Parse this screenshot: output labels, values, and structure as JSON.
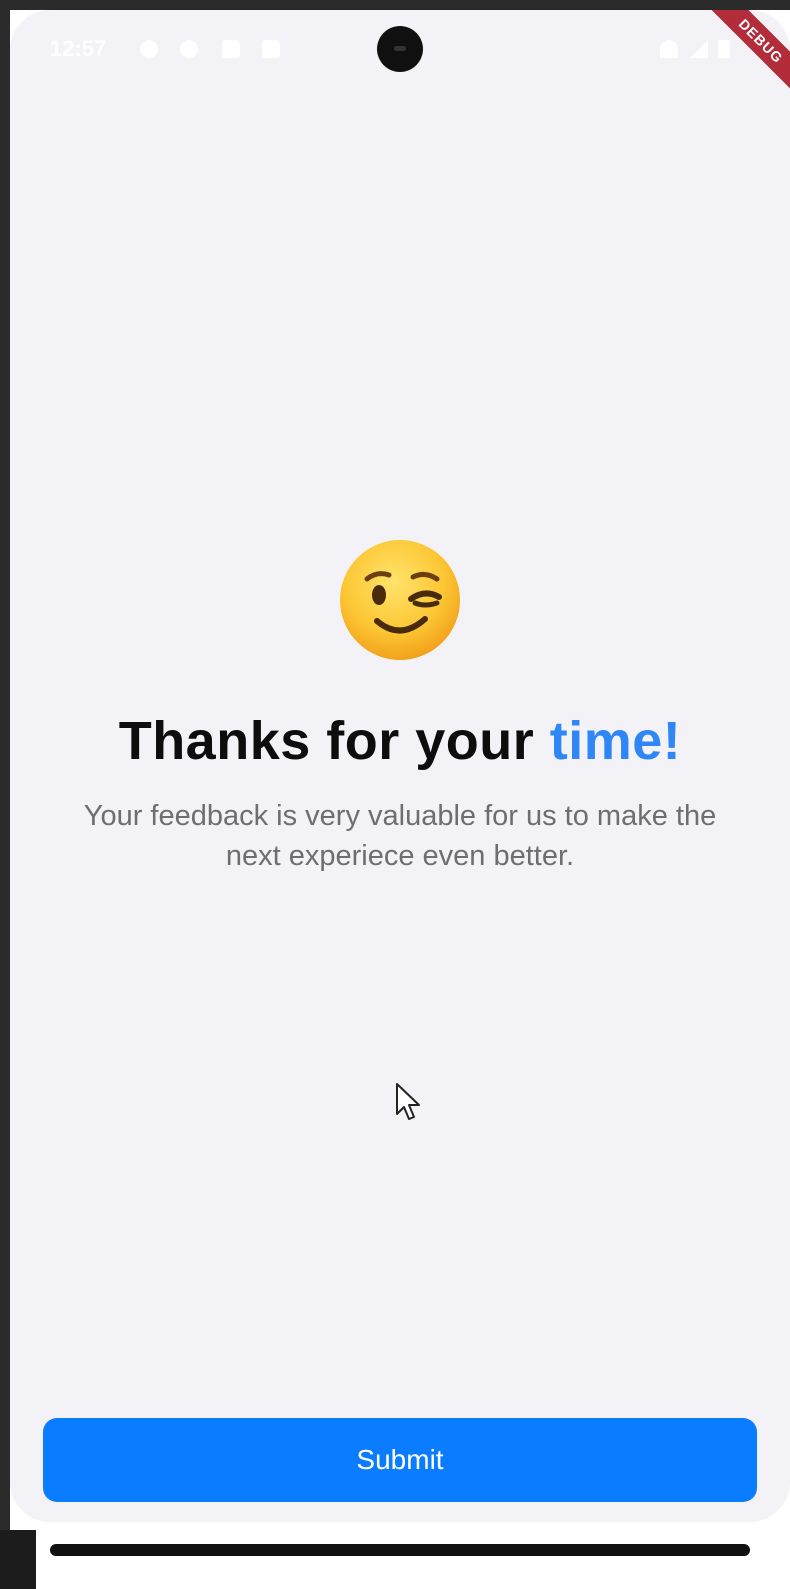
{
  "status_bar": {
    "time": "12:57"
  },
  "debug_banner": {
    "label": "DEBUG"
  },
  "feedback": {
    "emoji_icon": "winking-face-icon",
    "title_main": "Thanks for your ",
    "title_accent": "time!",
    "message": "Your feedback is very valuable for us to make the next experiece even better."
  },
  "actions": {
    "submit_label": "Submit"
  },
  "colors": {
    "background": "#f3f3f7",
    "accent_text": "#2f86f6",
    "button": "#0a7cff",
    "title_text": "#0d0d0d",
    "body_text": "#6e6e72"
  }
}
